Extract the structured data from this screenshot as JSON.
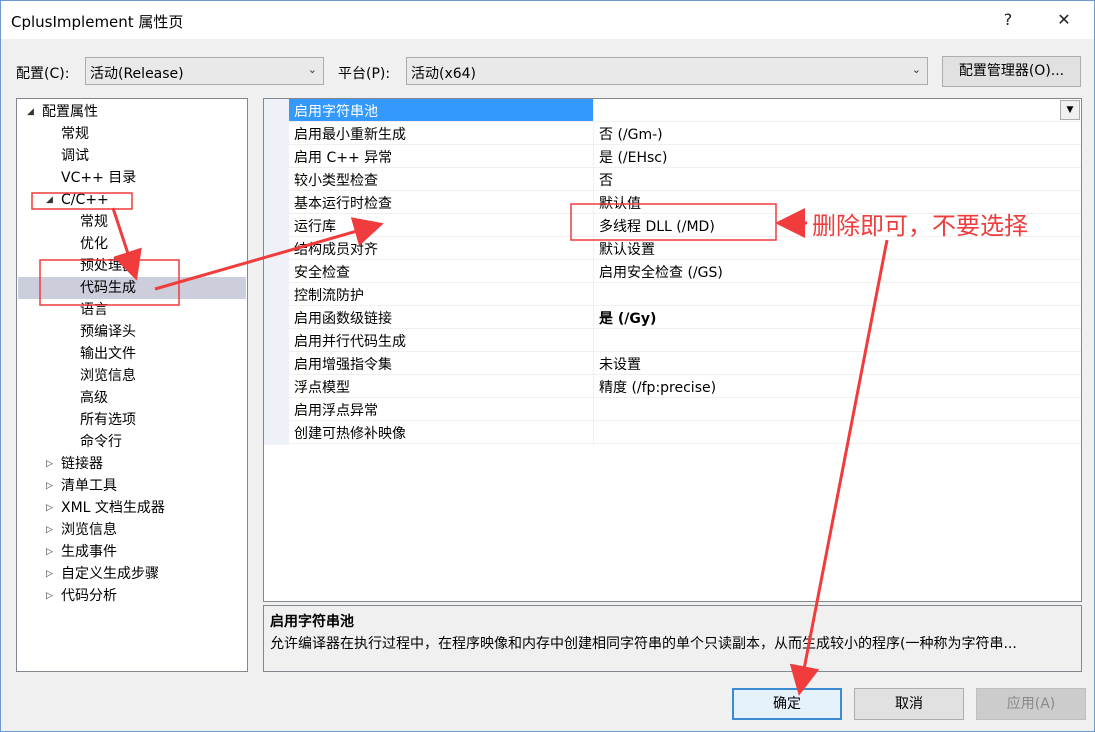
{
  "window": {
    "title": "CplusImplement 属性页",
    "help_glyph": "?",
    "close_glyph": "✕"
  },
  "toolbar": {
    "config_label": "配置(C):",
    "config_value": "活动(Release)",
    "platform_label": "平台(P):",
    "platform_value": "活动(x64)",
    "config_manager_label": "配置管理器(O)..."
  },
  "tree": {
    "items": [
      {
        "label": "配置属性",
        "expander": "◢"
      },
      {
        "label": "常规"
      },
      {
        "label": "调试"
      },
      {
        "label": "VC++ 目录"
      },
      {
        "label": "C/C++",
        "expander": "◢"
      },
      {
        "label": "常规"
      },
      {
        "label": "优化"
      },
      {
        "label": "预处理器"
      },
      {
        "label": "代码生成",
        "selected": true
      },
      {
        "label": "语言"
      },
      {
        "label": "预编译头"
      },
      {
        "label": "输出文件"
      },
      {
        "label": "浏览信息"
      },
      {
        "label": "高级"
      },
      {
        "label": "所有选项"
      },
      {
        "label": "命令行"
      },
      {
        "label": "链接器",
        "expander": "▷"
      },
      {
        "label": "清单工具",
        "expander": "▷"
      },
      {
        "label": "XML 文档生成器",
        "expander": "▷"
      },
      {
        "label": "浏览信息",
        "expander": "▷"
      },
      {
        "label": "生成事件",
        "expander": "▷"
      },
      {
        "label": "自定义生成步骤",
        "expander": "▷"
      },
      {
        "label": "代码分析",
        "expander": "▷"
      }
    ]
  },
  "properties": {
    "rows": [
      {
        "name": "启用字符串池",
        "value": "",
        "selected": true
      },
      {
        "name": "启用最小重新生成",
        "value": "否 (/Gm-)"
      },
      {
        "name": "启用 C++ 异常",
        "value": "是 (/EHsc)"
      },
      {
        "name": "较小类型检查",
        "value": "否"
      },
      {
        "name": "基本运行时检查",
        "value": "默认值"
      },
      {
        "name": "运行库",
        "value": "多线程 DLL (/MD)"
      },
      {
        "name": "结构成员对齐",
        "value": "默认设置"
      },
      {
        "name": "安全检查",
        "value": "启用安全检查 (/GS)"
      },
      {
        "name": "控制流防护",
        "value": ""
      },
      {
        "name": "启用函数级链接",
        "value": "是 (/Gy)",
        "bold": true
      },
      {
        "name": "启用并行代码生成",
        "value": ""
      },
      {
        "name": "启用增强指令集",
        "value": "未设置"
      },
      {
        "name": "浮点模型",
        "value": "精度 (/fp:precise)"
      },
      {
        "name": "启用浮点异常",
        "value": ""
      },
      {
        "name": "创建可热修补映像",
        "value": ""
      }
    ]
  },
  "description": {
    "title": "启用字符串池",
    "text": "允许编译器在执行过程中，在程序映像和内存中创建相同字符串的单个只读副本，从而生成较小的程序(一种称为字符串..."
  },
  "buttons": {
    "ok": "确定",
    "cancel": "取消",
    "apply": "应用(A)"
  },
  "annotation": {
    "text": "删除即可，不要选择",
    "color": "#f03c3c"
  },
  "icons": {
    "dropdown": "chevron-down-icon"
  }
}
